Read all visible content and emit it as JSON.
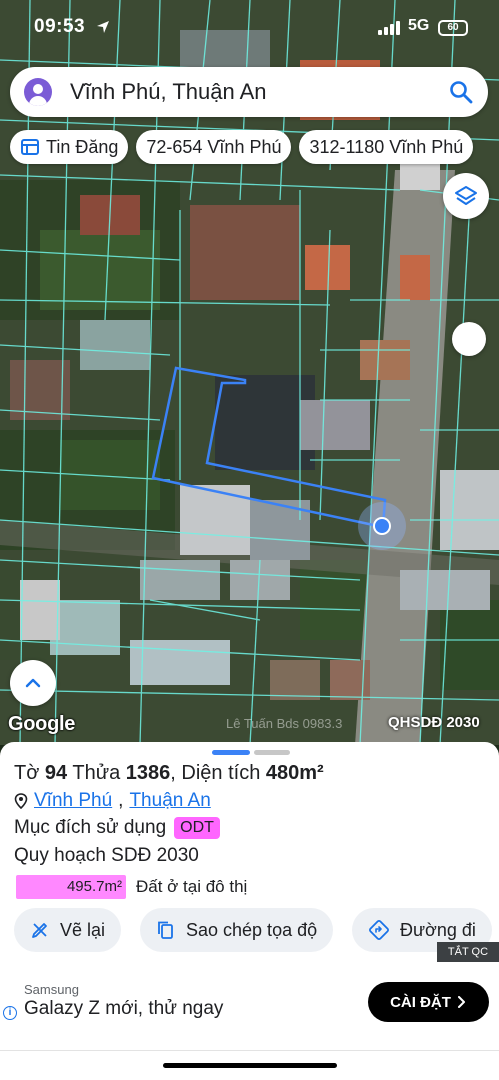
{
  "status_bar": {
    "time": "09:53",
    "network": "5G",
    "battery": "60"
  },
  "search": {
    "query": "Vĩnh Phú, Thuận An"
  },
  "chips": [
    {
      "label": "Tin Đăng",
      "icon": "listing-icon"
    },
    {
      "label": "72-654 Vĩnh Phú"
    },
    {
      "label": "312-1180 Vĩnh Phú"
    }
  ],
  "map": {
    "google_logo": "Google",
    "watermark": "Lê Tuấn Bds 0983.3",
    "credit": "QHSDĐ 2030",
    "parcel_color": "#3b82f6",
    "boundary_color": "#6ff3e6"
  },
  "parcel": {
    "sheet_label": "Tờ",
    "sheet_no": "94",
    "lot_label": "Thửa",
    "lot_no": "1386",
    "area_label": "Diện tích",
    "area": "480m²",
    "ward": "Vĩnh Phú",
    "city": "Thuận An",
    "purpose_label": "Mục đích sử dụng",
    "purpose_code": "ODT",
    "plan_label": "Quy hoạch SDĐ 2030",
    "plan_area": "495.7m²",
    "plan_desc": "Đất ở tại đô thị",
    "plan_color": "#ff88ff"
  },
  "actions": {
    "redraw": "Vẽ lại",
    "copy_coords": "Sao chép tọa độ",
    "directions": "Đường đi"
  },
  "ad": {
    "tag": "TẮT QC",
    "brand": "Samsung",
    "headline": "Galazy Z mới, thử ngay",
    "cta": "CÀI ĐẶT"
  }
}
